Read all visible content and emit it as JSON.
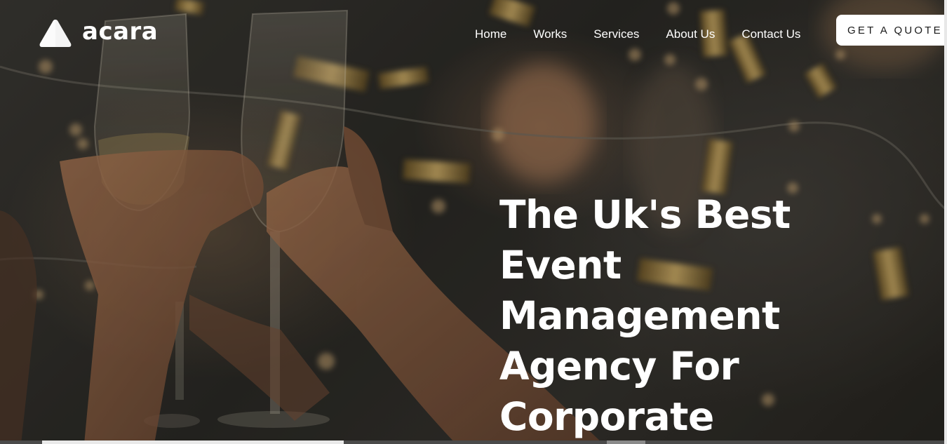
{
  "brand": {
    "name": "acara"
  },
  "nav": {
    "items": [
      {
        "label": "Home"
      },
      {
        "label": "Works"
      },
      {
        "label": "Services"
      },
      {
        "label": "About Us"
      },
      {
        "label": "Contact Us"
      }
    ]
  },
  "cta": {
    "label": "GET A QUOTE"
  },
  "hero": {
    "title_lines": [
      "The Uk's Best",
      "Event",
      "Management",
      "Agency For",
      "Corporate"
    ]
  },
  "colors": {
    "text": "#ffffff",
    "button_bg": "#ffffff",
    "button_text": "#1a1a1a",
    "confetti_gold": "#b8934a"
  },
  "icons": {
    "logo": "triangle-logo-icon"
  }
}
